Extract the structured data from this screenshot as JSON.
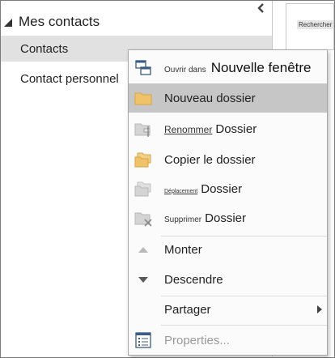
{
  "folders": {
    "group_label": "Mes contacts",
    "items": [
      {
        "label": "Contacts"
      },
      {
        "label": "Contact personnel"
      }
    ]
  },
  "search": {
    "label": "Rechercher"
  },
  "context_menu": {
    "open_window": {
      "small": "Ouvrir dans",
      "large": "Nouvelle fenêtre",
      "icon": "window-stack-icon"
    },
    "new_folder": {
      "label": "Nouveau dossier",
      "icon": "folder-icon"
    },
    "rename": {
      "small": "Renommer",
      "large": "Dossier",
      "icon": "rename-folder-icon"
    },
    "copy": {
      "label": "Copier le dossier",
      "icon": "copy-folder-icon"
    },
    "move": {
      "small": "Déplacement",
      "large": "Dossier",
      "icon": "move-folder-icon"
    },
    "delete": {
      "small": "Supprimer",
      "large": "Dossier",
      "icon": "delete-folder-icon"
    },
    "move_up": {
      "label": "Monter",
      "icon": "triangle-up-icon"
    },
    "move_down": {
      "label": "Descendre",
      "icon": "triangle-down-icon"
    },
    "share": {
      "label": "Partager"
    },
    "properties": {
      "label": "Properties...",
      "icon": "properties-list-icon"
    }
  },
  "colors": {
    "highlight": "#c6c6c6",
    "folder_yellow": "#f0c36b",
    "selected_row": "#e1e1e1"
  }
}
